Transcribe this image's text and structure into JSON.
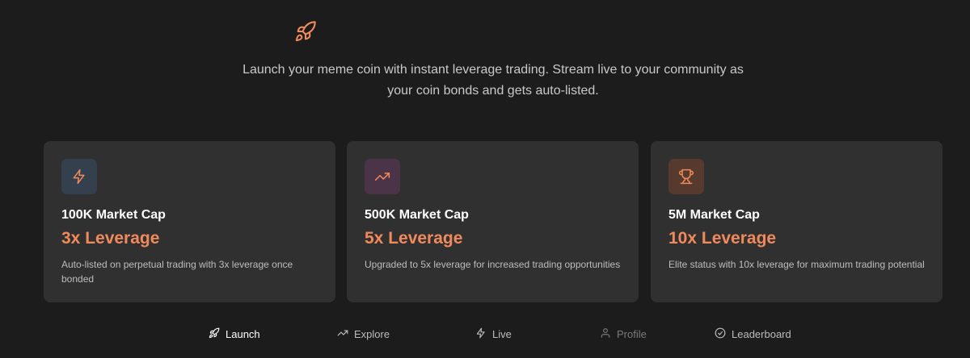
{
  "hero": {
    "icon": "rocket-icon",
    "tagline": "Launch your meme coin with instant leverage trading. Stream live to your community as your coin bonds and gets auto-listed."
  },
  "cards": [
    {
      "icon": "lightning-icon",
      "icon_bg": "#34404d",
      "icon_color": "#f08a5d",
      "title": "100K Market Cap",
      "leverage": "3x Leverage",
      "description": "Auto-listed on perpetual trading with 3x leverage once bonded"
    },
    {
      "icon": "trending-up-icon",
      "icon_bg": "#4b3447",
      "icon_color": "#f08a5d",
      "title": "500K Market Cap",
      "leverage": "5x Leverage",
      "description": "Upgraded to 5x leverage for increased trading opportunities"
    },
    {
      "icon": "trophy-icon",
      "icon_bg": "#573a2e",
      "icon_color": "#f08a5d",
      "title": "5M Market Cap",
      "leverage": "10x Leverage",
      "description": "Elite status with 10x leverage for maximum trading potential"
    }
  ],
  "nav": {
    "items": [
      {
        "label": "Launch",
        "icon": "rocket-icon",
        "state": "active"
      },
      {
        "label": "Explore",
        "icon": "trending-up-icon",
        "state": "normal"
      },
      {
        "label": "Live",
        "icon": "lightning-icon",
        "state": "normal"
      },
      {
        "label": "Profile",
        "icon": "user-icon",
        "state": "disabled"
      },
      {
        "label": "Leaderboard",
        "icon": "check-circle-icon",
        "state": "normal"
      }
    ]
  },
  "colors": {
    "background": "#1c1c1c",
    "card": "#303030",
    "accent": "#f08a5d"
  }
}
